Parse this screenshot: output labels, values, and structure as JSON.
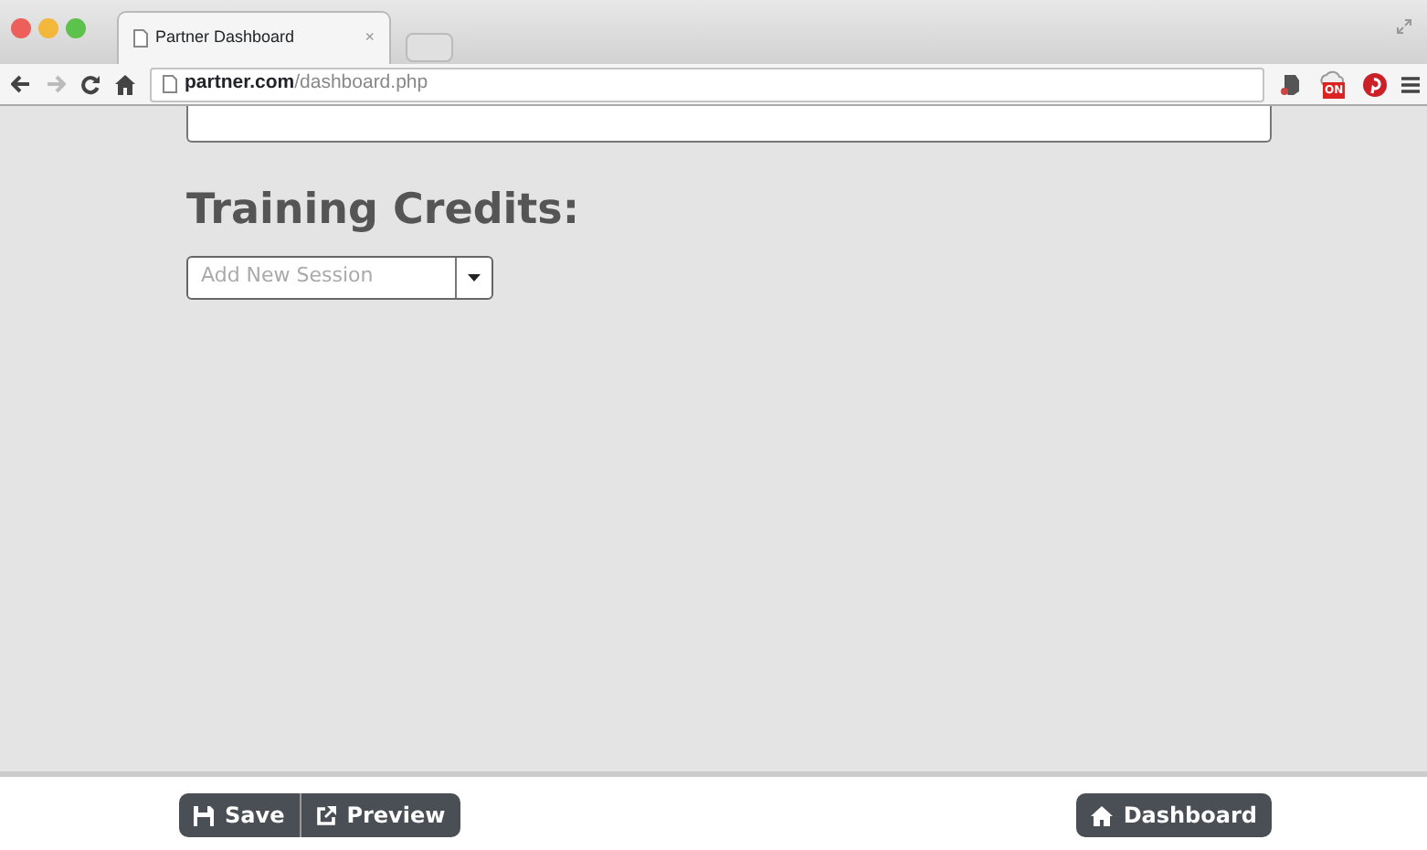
{
  "browser": {
    "tab_title": "Partner Dashboard",
    "tab_close": "×",
    "url_host": "partner.com",
    "url_path": "/dashboard.php",
    "extension_badge": "ON"
  },
  "page": {
    "heading": "Training Credits:",
    "session_select": {
      "placeholder": "Add New Session"
    }
  },
  "footer": {
    "left_buttons": [
      {
        "label": "Save",
        "kind": "save"
      },
      {
        "label": "Preview",
        "kind": "external"
      }
    ],
    "right_button": {
      "label": "Dashboard",
      "kind": "home"
    }
  }
}
